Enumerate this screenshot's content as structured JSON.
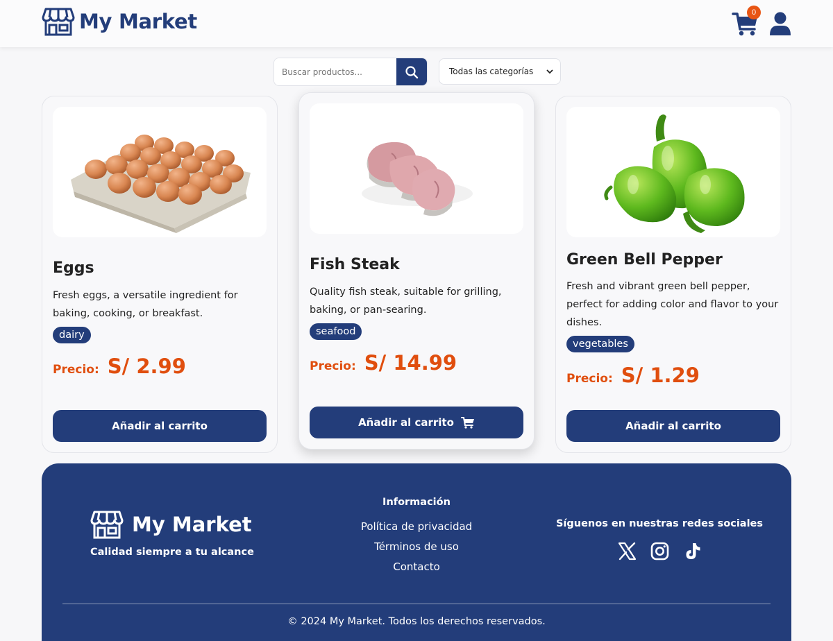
{
  "header": {
    "brand": "My Market",
    "cart_count": "0"
  },
  "search": {
    "placeholder": "Buscar productos...",
    "category_selected": "Todas las categorías"
  },
  "products": [
    {
      "name": "Eggs",
      "description": "Fresh eggs, a versatile ingredient for baking, cooking, or breakfast.",
      "category": "dairy",
      "price_label": "Precio:",
      "price": "S/ 2.99",
      "button_label": "Añadir al carrito",
      "image_icon": "eggs-image"
    },
    {
      "name": "Fish Steak",
      "description": "Quality fish steak, suitable for grilling, baking, or pan-searing.",
      "category": "seafood",
      "price_label": "Precio:",
      "price": "S/ 14.99",
      "button_label": "Añadir al carrito",
      "image_icon": "fish-steak-image"
    },
    {
      "name": "Green Bell Pepper",
      "description": "Fresh and vibrant green bell pepper, perfect for adding color and flavor to your dishes.",
      "category": "vegetables",
      "price_label": "Precio:",
      "price": "S/ 1.29",
      "button_label": "Añadir al carrito",
      "image_icon": "bell-pepper-image"
    }
  ],
  "footer": {
    "brand": "My Market",
    "tagline": "Calidad siempre a tu alcance",
    "info_title": "Información",
    "links": [
      "Política de privacidad",
      "Términos de uso",
      "Contacto"
    ],
    "social_title": "Síguenos en nuestras redes sociales",
    "social_icons": [
      "x-icon",
      "instagram-icon",
      "tiktok-icon"
    ],
    "copyright": "© 2024 My Market. Todos los derechos reservados."
  },
  "colors": {
    "primary": "#233d7a",
    "accent": "#e04e0e",
    "badge": "#e85514",
    "background": "#f7f7f9"
  }
}
